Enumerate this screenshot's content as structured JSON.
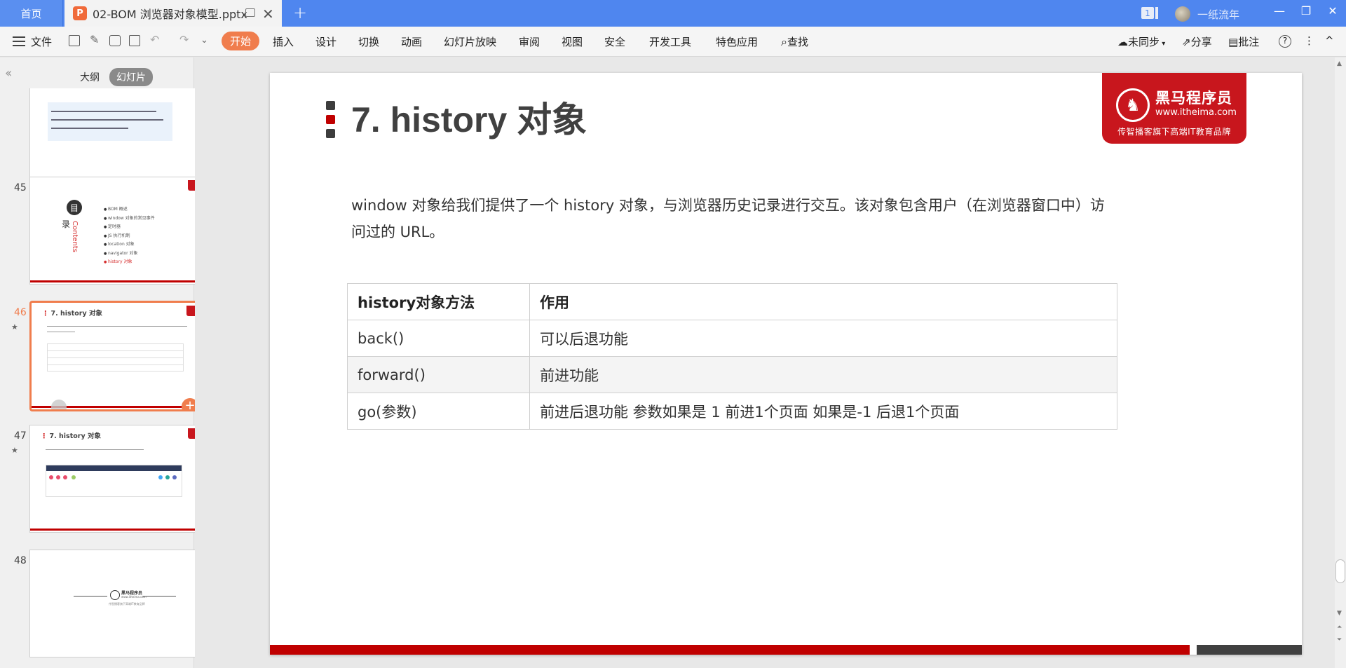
{
  "titlebar": {
    "home_tab": "首页",
    "doc_tab": "02-BOM 浏览器对象模型.pptx",
    "ppt_icon_letter": "P",
    "new_tab": "+",
    "close": "✕",
    "badge": "1",
    "user_name": "一纸流年",
    "win_min": "—",
    "win_restore": "❐",
    "win_close": "✕"
  },
  "ribbon": {
    "file": "文件",
    "tabs": [
      "开始",
      "插入",
      "设计",
      "切换",
      "动画",
      "幻灯片放映",
      "审阅",
      "视图",
      "安全",
      "开发工具",
      "特色应用"
    ],
    "search": "查找",
    "sync": "未同步",
    "share": "分享",
    "comment": "批注",
    "help": "?",
    "more": "⋮",
    "collapse": "^"
  },
  "left_panel": {
    "tabs": [
      "大纲",
      "幻灯片"
    ],
    "active_tab": "幻灯片",
    "thumbnails": [
      {
        "number": "45",
        "title": ""
      },
      {
        "number": "46",
        "title": "7. history 对象",
        "selected": true
      },
      {
        "number": "47",
        "title": "7. history 对象"
      },
      {
        "number": "48",
        "title": ""
      }
    ],
    "thumb45_bullets": [
      "BOM 概述",
      "window 对象的常见事件",
      "定时器",
      "JS 执行机制",
      "location 对象",
      "navigator 对象",
      "history 对象"
    ],
    "thumb45_big_char": "目",
    "thumb45_small_char": "录",
    "thumb45_contents": "Contents",
    "thumb48_logo": "黑马程序员",
    "thumb48_url": "www.itheima.com",
    "thumb48_tag": "传智播客旗下高端IT教育品牌"
  },
  "slide": {
    "title": "7. history 对象",
    "logo": {
      "name": "黑马程序员",
      "url": "www.itheima.com",
      "tagline": "传智播客旗下高端IT教育品牌"
    },
    "description": "window 对象给我们提供了一个 history 对象，与浏览器历史记录进行交互。该对象包含用户（在浏览器窗口中）访问过的 URL。",
    "table": {
      "headers": [
        "history对象方法",
        "作用"
      ],
      "rows": [
        [
          "back()",
          "可以后退功能"
        ],
        [
          "forward()",
          "前进功能"
        ],
        [
          "go(参数)",
          "前进后退功能 参数如果是 1 前进1个页面 如果是-1 后退1个页面"
        ]
      ]
    }
  },
  "colors": {
    "titlebar": "#4f86ef",
    "accent_orange": "#f07d4d",
    "brand_red": "#c8161d",
    "slide_red": "#c00000"
  }
}
